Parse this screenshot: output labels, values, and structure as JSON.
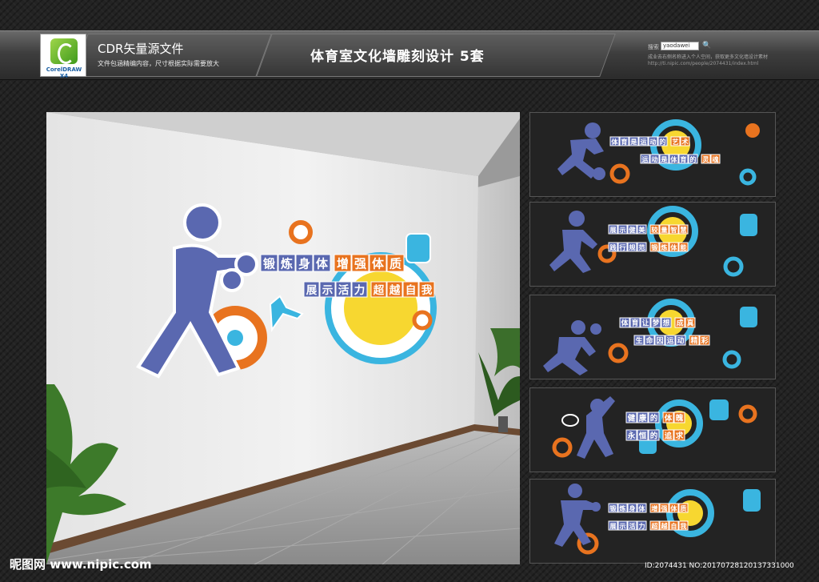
{
  "header": {
    "logo_text": "CorelDRAW X4",
    "cdr_title": "CDR矢量源文件",
    "cdr_subtitle": "文件包涵精编内容，尺寸根据实际需要放大",
    "main_title": "体育室文化墙雕刻设计  5套",
    "search_label": "搜索",
    "search_value": "yaodawei",
    "search_button": "🔍",
    "promo_text": "成业去右侧名称进入个人空间，获取更多文化墙设计素材",
    "url_text": "http://ti.nipic.com/people/2074431/index.html"
  },
  "main_wall": {
    "row1": [
      "锻",
      "炼",
      "身",
      "体",
      "增",
      "强",
      "体",
      "质"
    ],
    "row2": [
      "展",
      "示",
      "活",
      "力",
      "超",
      "越",
      "自",
      "我"
    ]
  },
  "thumbnails": [
    {
      "row1": [
        "体",
        "育",
        "是",
        "运",
        "动",
        "的",
        "艺",
        "术"
      ],
      "row2": [
        "运",
        "动",
        "是",
        "体",
        "育",
        "的",
        "灵",
        "魂"
      ]
    },
    {
      "row1": [
        "展",
        "示",
        "健",
        "美",
        "较",
        "量",
        "智",
        "慧"
      ],
      "row2": [
        "践",
        "行",
        "规",
        "范",
        "锻",
        "炼",
        "体",
        "能"
      ]
    },
    {
      "row1": [
        "体",
        "育",
        "让",
        "梦",
        "想",
        "成",
        "真"
      ],
      "row2": [
        "生",
        "命",
        "因",
        "运",
        "动",
        "精",
        "彩"
      ]
    },
    {
      "row1": [
        "健",
        "康",
        "的",
        "体",
        "魄"
      ],
      "row2": [
        "永",
        "恒",
        "的",
        "追",
        "求"
      ]
    },
    {
      "row1": [
        "锻",
        "炼",
        "身",
        "体",
        "增",
        "强",
        "体",
        "质"
      ],
      "row2": [
        "展",
        "示",
        "活",
        "力",
        "超",
        "越",
        "自",
        "我"
      ]
    }
  ],
  "footer": {
    "site_logo": "昵图网 www.nipic.com",
    "image_id": "ID:2074431 NO:20170728120137331000"
  },
  "colors": {
    "blue": "#5a68b0",
    "orange": "#e8731f",
    "cyan": "#3ab5e0",
    "yellow": "#f7d730"
  }
}
